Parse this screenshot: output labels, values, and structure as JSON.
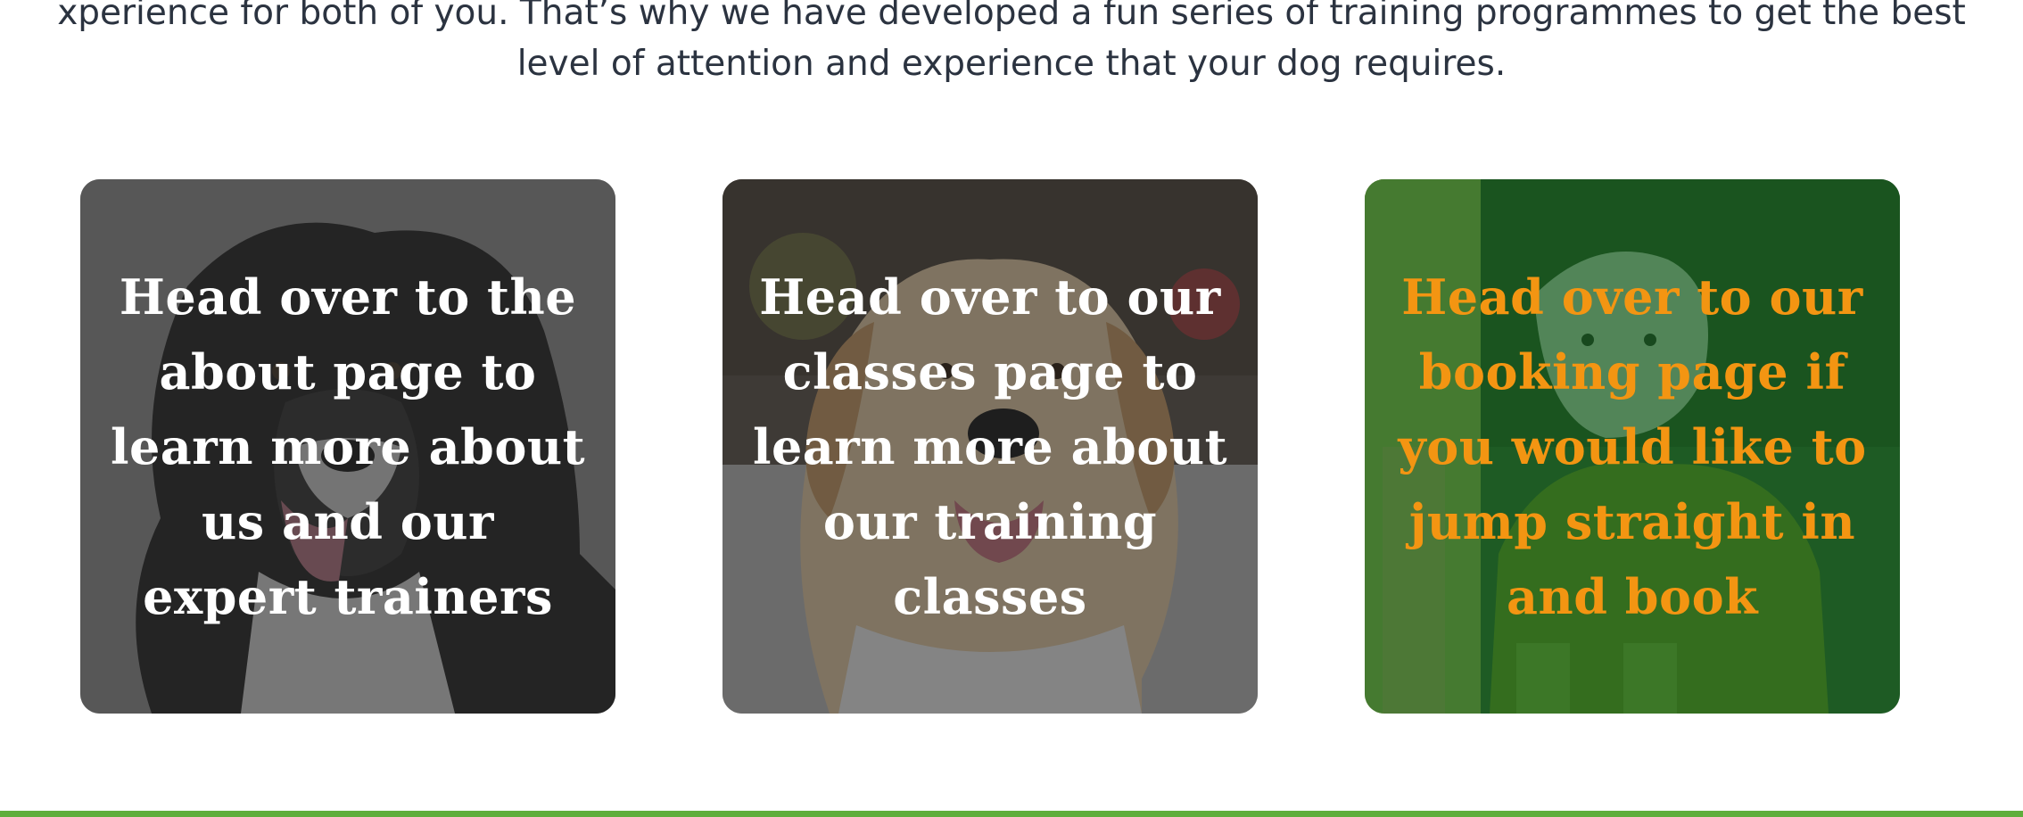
{
  "intro": {
    "line1": "xperience for both of you. That’s why we have developed a fun series of training programmes to get the best",
    "line2": "level of attention and experience that your dog requires."
  },
  "cards": [
    {
      "text": "Head over to the about page to learn more about us and our expert trainers",
      "text_color": "#ffffff",
      "overlay_color": "#2d2d2d",
      "photo": "border-collie-photo"
    },
    {
      "text": "Head over to our classes page to learn more about our training classes",
      "text_color": "#ffffff",
      "overlay_color": "#282828",
      "photo": "golden-retriever-photo"
    },
    {
      "text": "Head over to our booking page if you would like to jump straight in and book",
      "text_color": "#f39512",
      "overlay_color": "#185c20",
      "photo": "dog-in-raincoat-photo"
    }
  ],
  "colors": {
    "body_text": "#2b3340",
    "footer_bar": "#5fae3b",
    "accent_orange": "#f39512"
  }
}
